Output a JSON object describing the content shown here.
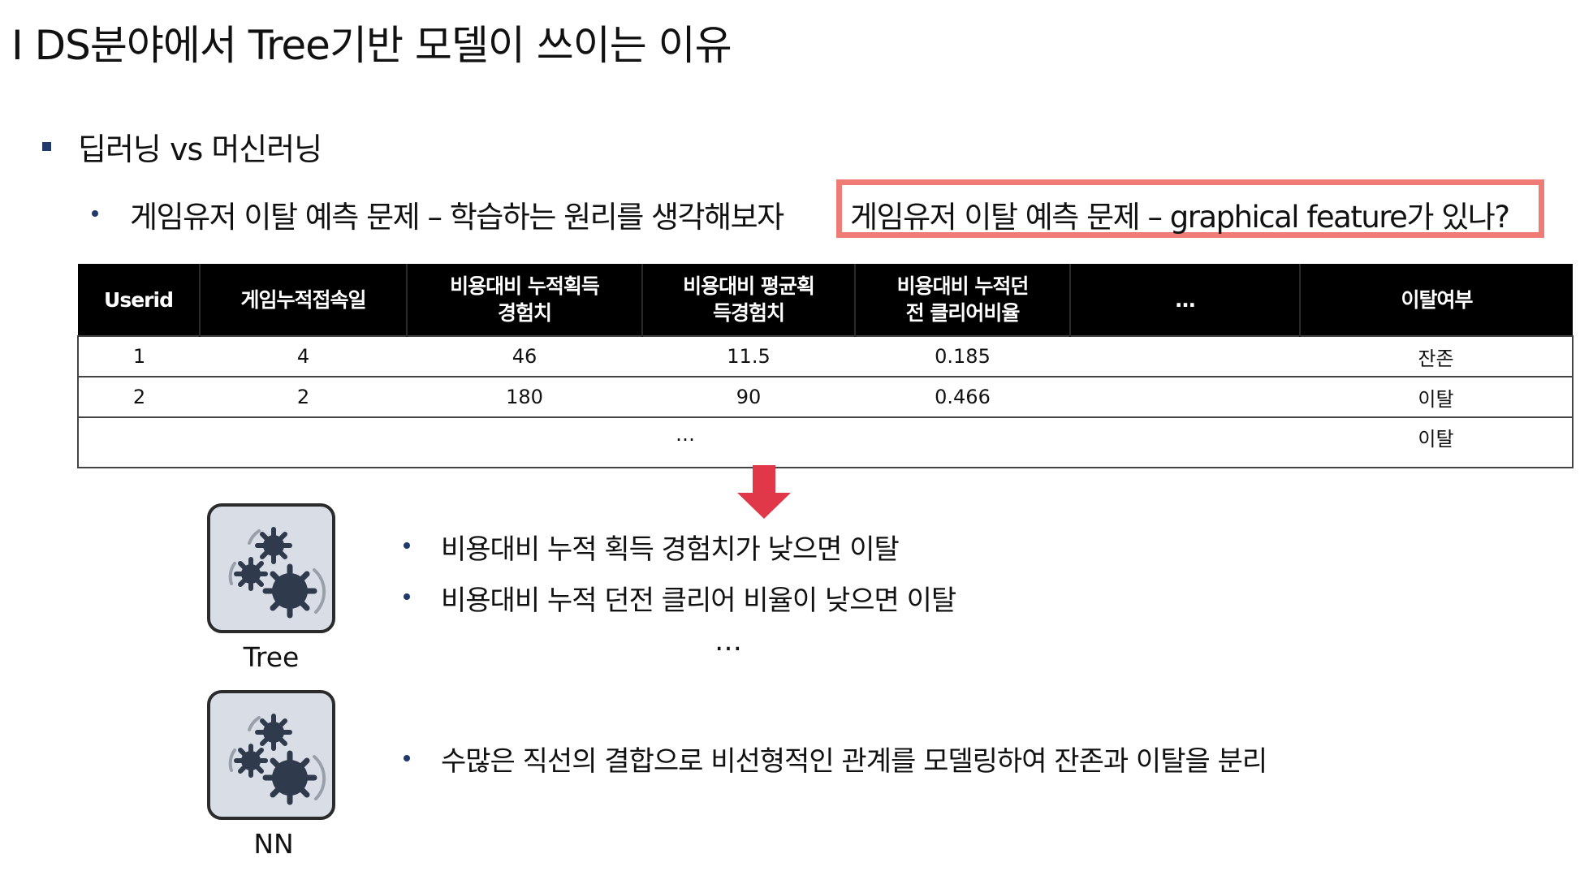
{
  "title": "I DS분야에서 Tree기반 모델이 쓰이는 이유",
  "bullet1": "딥러닝 vs 머신러닝",
  "bullet2": "게임유저 이탈 예측 문제 – 학습하는 원리를 생각해보자",
  "highlight": "게임유저 이탈 예측 문제 – graphical feature가 있나?",
  "table": {
    "headers": [
      [
        "Userid"
      ],
      [
        "게임누적접속일"
      ],
      [
        "비용대비 누적획득",
        "경험치"
      ],
      [
        "비용대비 평균획",
        "득경험치"
      ],
      [
        "비용대비 누적던",
        "전 클리어비율"
      ],
      [
        "…"
      ],
      [
        "이탈여부"
      ]
    ],
    "rows": [
      [
        "1",
        "4",
        "46",
        "11.5",
        "0.185",
        "",
        "잔존"
      ],
      [
        "2",
        "2",
        "180",
        "90",
        "0.466",
        "",
        "이탈"
      ]
    ],
    "ellipsis_row": {
      "middle": "…",
      "last": "이탈"
    }
  },
  "models": [
    {
      "label": "Tree",
      "icon": "gears-icon"
    },
    {
      "label": "NN",
      "icon": "gears-icon"
    }
  ],
  "tree_points": [
    "비용대비 누적 획득 경험치가 낮으면 이탈",
    "비용대비 누적 던전 클리어 비율이 낮으면 이탈"
  ],
  "tree_ellipsis": "…",
  "nn_point": "수많은 직선의 결합으로 비선형적인 관계를 모델링하여 잔존과 이탈을 분리",
  "colors": {
    "highlight_border": "#ee7b75",
    "arrow": "#e03848",
    "bullet": "#1f3a6b",
    "card_bg": "#d9dde6",
    "gear": "#2f3a4d"
  }
}
